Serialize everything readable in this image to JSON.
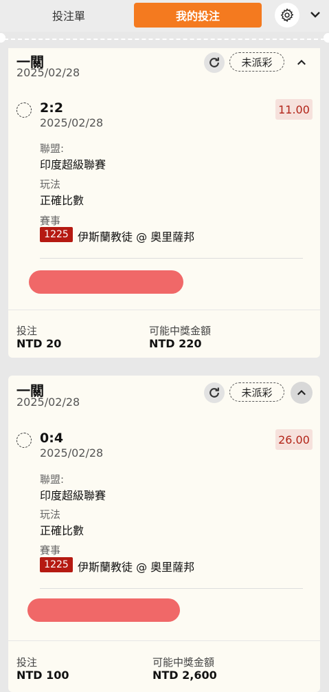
{
  "header": {
    "tab_betslip": "投注單",
    "tab_my_bets": "我的投注"
  },
  "bets": [
    {
      "title": "一關",
      "date": "2025/02/28",
      "status": "未派彩",
      "selection": {
        "score": "2:2",
        "date": "2025/02/28",
        "odds": "11.00",
        "league_label": "聯盟:",
        "league": "印度超級聯賽",
        "market_label": "玩法",
        "market": "正確比數",
        "event_label": "賽事",
        "event_id": "1225",
        "event_name": "伊斯蘭教徒 @ 奧里薩邦"
      },
      "stake_label": "投注",
      "stake": "NTD 20",
      "payout_label": "可能中獎金額",
      "payout": "NTD 220"
    },
    {
      "title": "一關",
      "date": "2025/02/28",
      "status": "未派彩",
      "selection": {
        "score": "0:4",
        "date": "2025/02/28",
        "odds": "26.00",
        "league_label": "聯盟:",
        "league": "印度超級聯賽",
        "market_label": "玩法",
        "market": "正確比數",
        "event_label": "賽事",
        "event_id": "1225",
        "event_name": "伊斯蘭教徒 @ 奧里薩邦"
      },
      "stake_label": "投注",
      "stake": "NTD 100",
      "payout_label": "可能中獎金額",
      "payout": "NTD 2,600"
    }
  ]
}
